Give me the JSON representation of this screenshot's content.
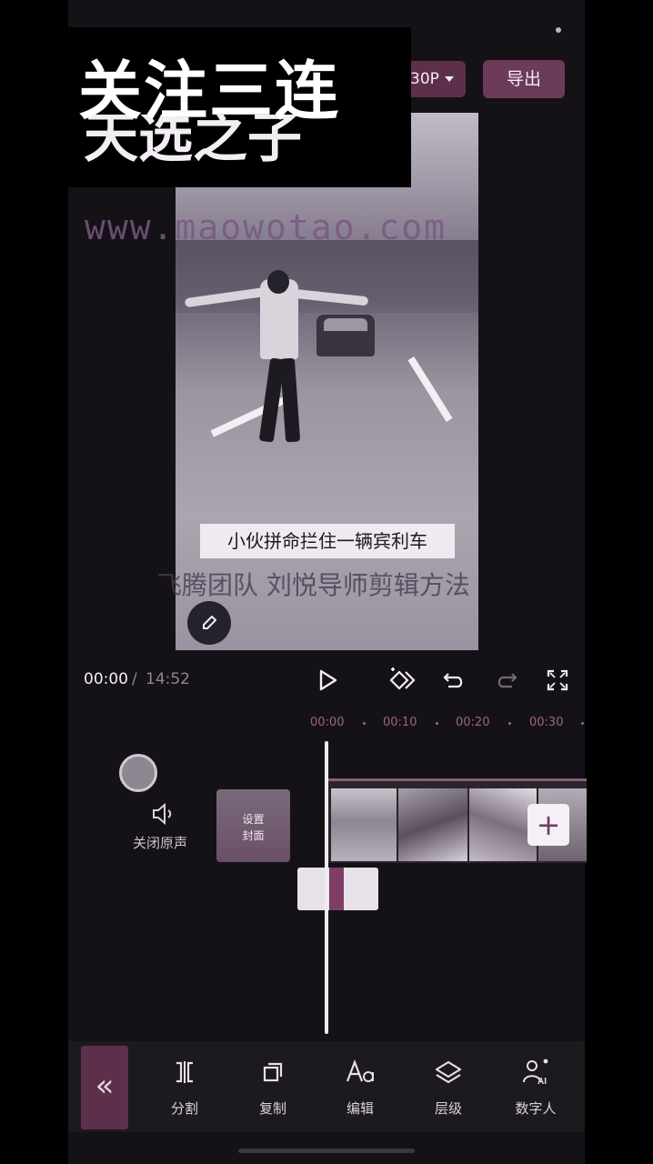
{
  "header": {
    "resolution_label": "30P",
    "export_label": "导出"
  },
  "overlay": {
    "banner_text": "关注三连",
    "ghost_text": "天选之子"
  },
  "preview": {
    "subtitle": "小伙拼命拦住一辆宾利车",
    "watermark_url": "www.maowotao.com",
    "watermark_team": "飞腾团队 刘悦导师剪辑方法"
  },
  "playback": {
    "current_time": "00:00",
    "separator": "/",
    "total_time": "14:52"
  },
  "timeline": {
    "ruler": [
      "00:00",
      "00:10",
      "00:20",
      "00:30"
    ],
    "mute_label": "关闭原声",
    "cover_label_1": "设置",
    "cover_label_2": "封面",
    "add_symbol": "+"
  },
  "toolbar": {
    "collapse_symbol": "«",
    "items": [
      {
        "label": "分割",
        "icon": "split-icon"
      },
      {
        "label": "复制",
        "icon": "copy-icon"
      },
      {
        "label": "编辑",
        "icon": "text-edit-icon"
      },
      {
        "label": "层级",
        "icon": "layers-icon"
      },
      {
        "label": "数字人",
        "icon": "digital-human-icon"
      }
    ]
  },
  "colors": {
    "accent": "#5d2f4a",
    "accent_text": "#a0608a",
    "background": "#141217"
  }
}
